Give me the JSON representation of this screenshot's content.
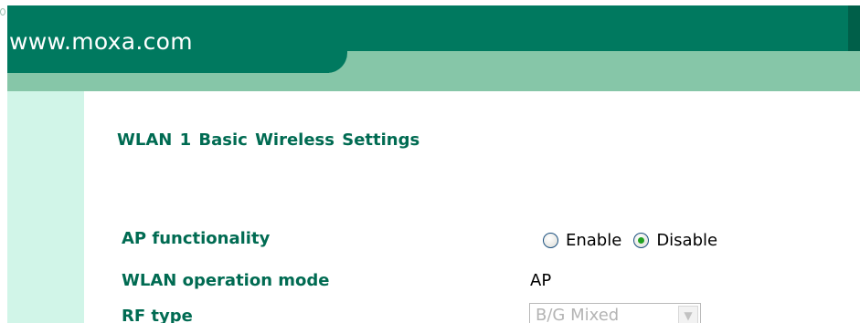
{
  "header": {
    "site_url": "www.moxa.com"
  },
  "page": {
    "title": "WLAN 1  Basic Wireless Settings"
  },
  "settings": {
    "ap_functionality": {
      "label": "AP functionality",
      "options": [
        "Enable",
        "Disable"
      ],
      "selected": "Disable"
    },
    "wlan_operation_mode": {
      "label": "WLAN operation mode",
      "value": "AP"
    },
    "rf_type": {
      "label": "RF type",
      "selected_value": "B/G Mixed",
      "disabled": true
    }
  },
  "colors": {
    "header_dark": "#00795f",
    "header_light": "#86c6a8",
    "sidebar": "#d1f5e8",
    "label_text": "#006b52",
    "radio_selected": "#21a121"
  }
}
